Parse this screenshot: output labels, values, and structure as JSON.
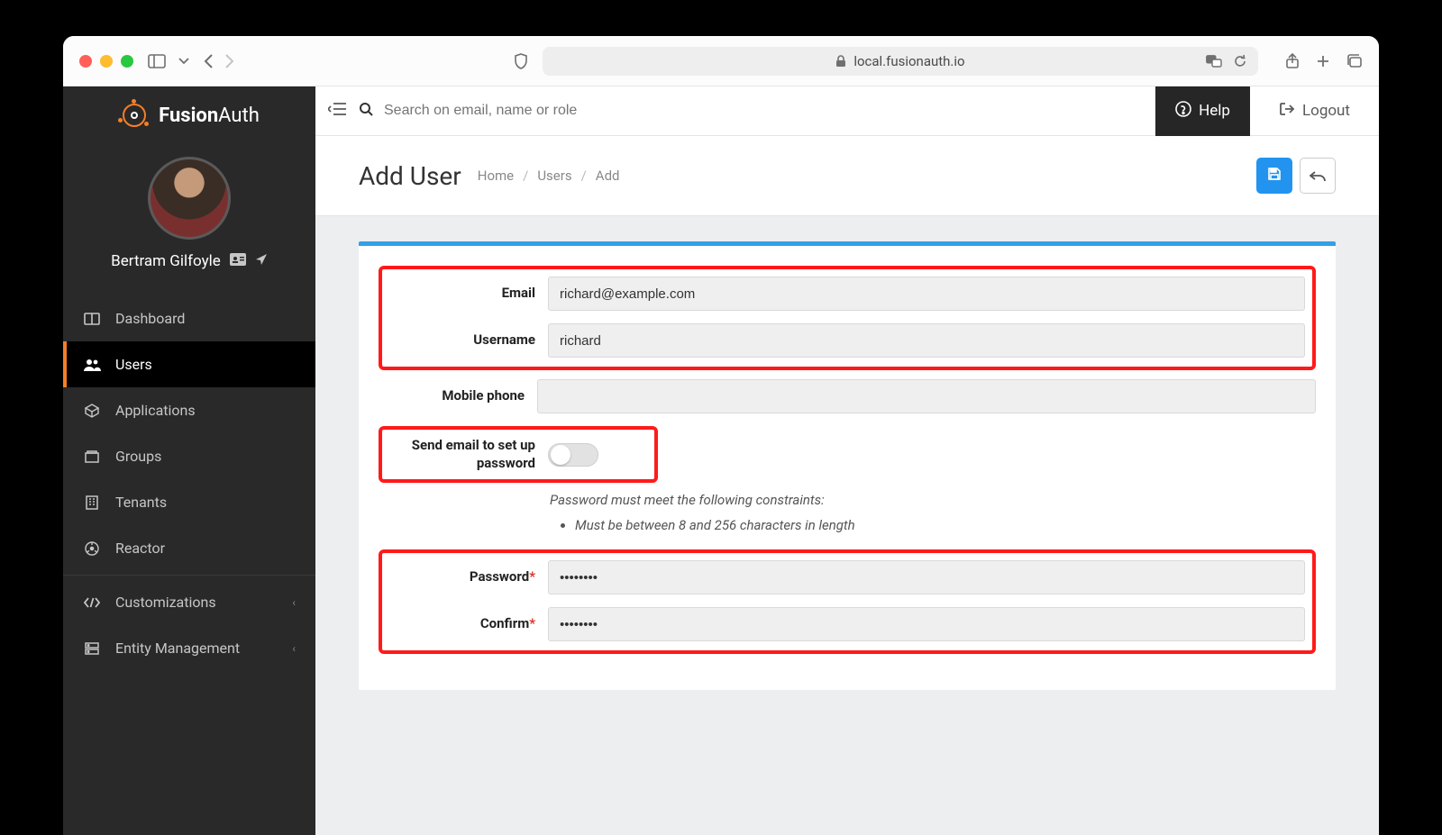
{
  "browser": {
    "address": "local.fusionauth.io"
  },
  "brand": {
    "name_prefix": "Fusion",
    "name_suffix": "Auth"
  },
  "profile": {
    "name": "Bertram Gilfoyle"
  },
  "sidebar": {
    "items": [
      {
        "label": "Dashboard"
      },
      {
        "label": "Users"
      },
      {
        "label": "Applications"
      },
      {
        "label": "Groups"
      },
      {
        "label": "Tenants"
      },
      {
        "label": "Reactor"
      }
    ],
    "secondary": [
      {
        "label": "Customizations"
      },
      {
        "label": "Entity Management"
      }
    ]
  },
  "topbar": {
    "search_placeholder": "Search on email, name or role",
    "help": "Help",
    "logout": "Logout"
  },
  "page": {
    "title": "Add User",
    "crumb_home": "Home",
    "crumb_users": "Users",
    "crumb_add": "Add"
  },
  "form": {
    "email_label": "Email",
    "email_value": "richard@example.com",
    "username_label": "Username",
    "username_value": "richard",
    "mobile_label": "Mobile phone",
    "mobile_value": "",
    "send_email_label": "Send email to set up password",
    "pw_hint_lead": "Password must meet the following constraints:",
    "pw_hint_rule": "Must be between 8 and 256 characters in length",
    "password_label": "Password",
    "confirm_label": "Confirm",
    "password_value": "••••••••",
    "confirm_value": "••••••••",
    "req_mark": "*"
  }
}
